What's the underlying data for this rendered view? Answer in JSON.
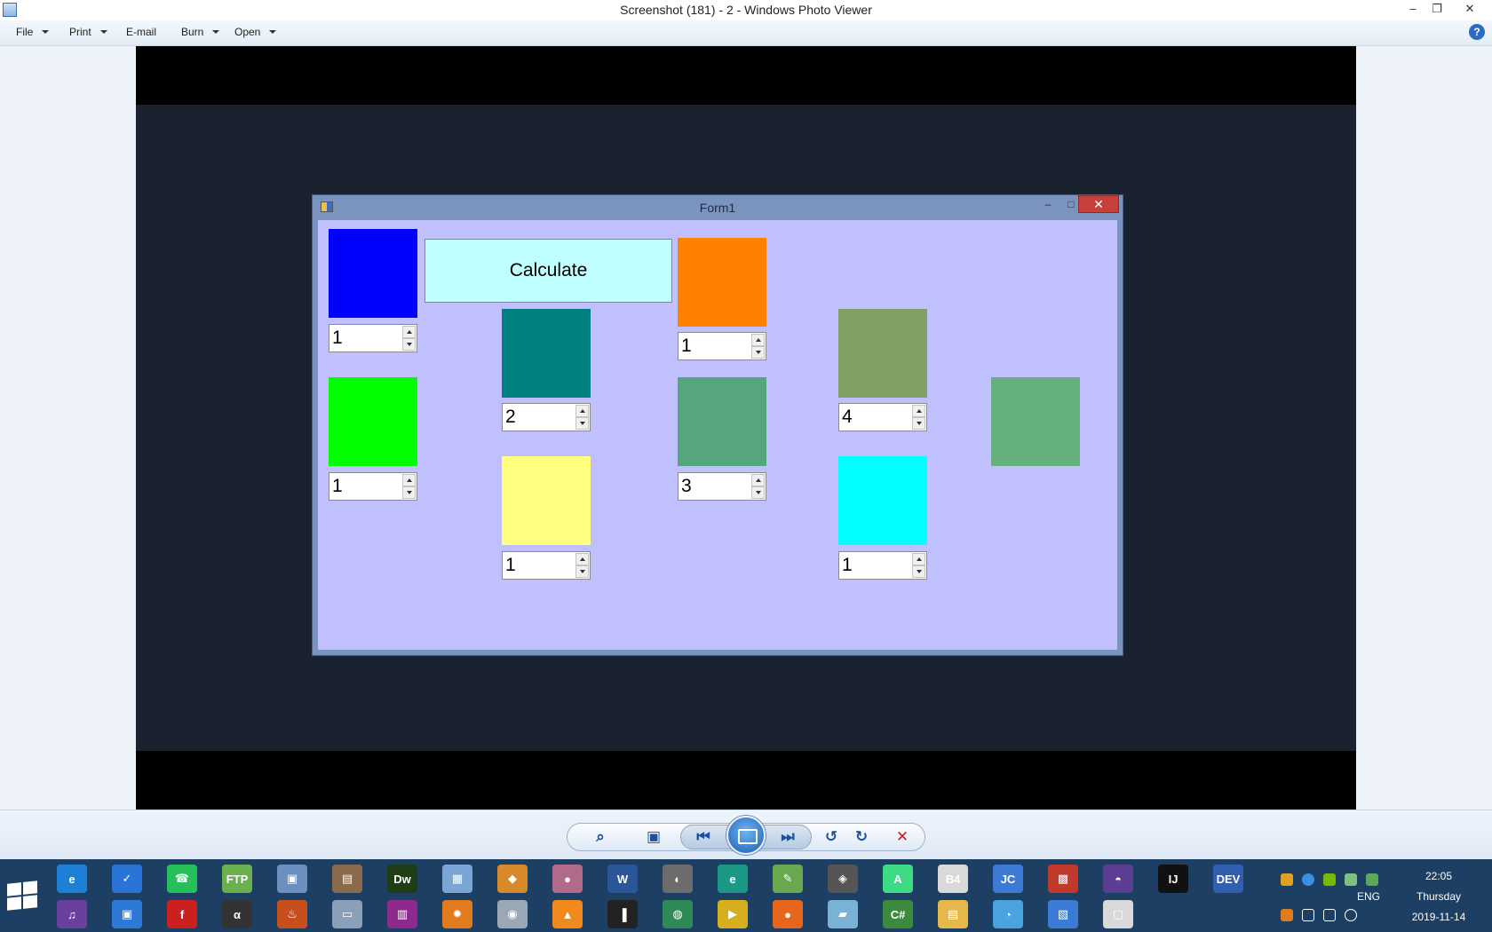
{
  "window": {
    "title": "Screenshot (181) - 2 - Windows Photo Viewer",
    "minimize": "–",
    "restore": "❐",
    "close": "✕"
  },
  "menu": {
    "file": "File",
    "print": "Print",
    "email": "E-mail",
    "burn": "Burn",
    "open": "Open",
    "help": "?"
  },
  "form": {
    "title": "Form1",
    "minimize": "–",
    "maximize": "□",
    "close": "✕",
    "calculate_label": "Calculate",
    "swatch_colors": {
      "blue": "#0000ff",
      "teal": "#008080",
      "orange": "#ff8000",
      "olive": "#809f60",
      "lime": "#00ff00",
      "seagreen": "#55a67e",
      "mintgreen": "#66b07e",
      "yellow": "#ffff80",
      "cyan": "#00ffff"
    },
    "spinners": {
      "blue": "1",
      "orange": "1",
      "teal": "2",
      "olive": "4",
      "lime": "1",
      "seagreen": "3",
      "yellow": "1",
      "cyan": "1"
    }
  },
  "controls": {
    "zoom_icon": "zoom-icon",
    "fit_icon": "fit-to-window-icon",
    "prev_icon": "previous-icon",
    "slideshow_icon": "slideshow-icon",
    "next_icon": "next-icon",
    "rotate_ccw_icon": "rotate-counterclockwise-icon",
    "rotate_cw_icon": "rotate-clockwise-icon",
    "delete_icon": "delete-icon"
  },
  "taskbar": {
    "language": "ENG",
    "time": "22:05",
    "day": "Thursday",
    "date": "2019-11-14",
    "row1": [
      {
        "name": "internet-explorer-icon",
        "label": "e",
        "color": "#1e7fd6"
      },
      {
        "name": "tasks-icon",
        "label": "✓",
        "color": "#2a74d8"
      },
      {
        "name": "whatsapp-icon",
        "label": "☎",
        "color": "#25c05a"
      },
      {
        "name": "cuteftp-icon",
        "label": "FTP",
        "color": "#6ab04c"
      },
      {
        "name": "computer-search-icon",
        "label": "▣",
        "color": "#6b8fbf"
      },
      {
        "name": "film-icon",
        "label": "▤",
        "color": "#8a6a4a"
      },
      {
        "name": "dreamweaver-icon",
        "label": "Dw",
        "color": "#1f3d17"
      },
      {
        "name": "calculator-icon",
        "label": "▦",
        "color": "#7aa6d6"
      },
      {
        "name": "paint-bucket-icon",
        "label": "◆",
        "color": "#d78a2a"
      },
      {
        "name": "disc-icon",
        "label": "●",
        "color": "#b06a8a"
      },
      {
        "name": "word-icon",
        "label": "W",
        "color": "#2b579a"
      },
      {
        "name": "shield-icon",
        "label": "◐",
        "color": "#6c6c6c"
      },
      {
        "name": "edge-e-icon",
        "label": "e",
        "color": "#1a9a86"
      },
      {
        "name": "notepad-plus-icon",
        "label": "✎",
        "color": "#6aa84f"
      },
      {
        "name": "penguin-icon",
        "label": "◈",
        "color": "#555555"
      },
      {
        "name": "android-studio-icon",
        "label": "A",
        "color": "#3ddc84"
      },
      {
        "name": "basic4android-icon",
        "label": "B4",
        "color": "#d9d9d9"
      },
      {
        "name": "jcreator-icon",
        "label": "JC",
        "color": "#3b7bd6"
      },
      {
        "name": "blocks-icon",
        "label": "▩",
        "color": "#c0392b"
      },
      {
        "name": "eclipse-icon",
        "label": "◓",
        "color": "#5b3e91"
      },
      {
        "name": "intellij-icon",
        "label": "IJ",
        "color": "#111111"
      },
      {
        "name": "devcpp-icon",
        "label": "DEV",
        "color": "#2f5fae"
      }
    ],
    "row2": [
      {
        "name": "music-icon",
        "label": "♫",
        "color": "#6a3fa0"
      },
      {
        "name": "window-switch-icon",
        "label": "▣",
        "color": "#2f79d6"
      },
      {
        "name": "flash-icon",
        "label": "f",
        "color": "#cc1f1f"
      },
      {
        "name": "alpha-icon",
        "label": "α",
        "color": "#333333"
      },
      {
        "name": "java-icon",
        "label": "♨",
        "color": "#c74f1c"
      },
      {
        "name": "monitor-icon",
        "label": "▭",
        "color": "#8aa0b8"
      },
      {
        "name": "winrar-icon",
        "label": "▥",
        "color": "#8e2a8e"
      },
      {
        "name": "paint-icon",
        "label": "✹",
        "color": "#e07b1e"
      },
      {
        "name": "camera-icon",
        "label": "◉",
        "color": "#9aa7b4"
      },
      {
        "name": "vlc-icon",
        "label": "▲",
        "color": "#f08a1c"
      },
      {
        "name": "piano-icon",
        "label": "▐",
        "color": "#222222"
      },
      {
        "name": "download-manager-icon",
        "label": "◍",
        "color": "#2e8b57"
      },
      {
        "name": "video-player-icon",
        "label": "▶",
        "color": "#d6b01c"
      },
      {
        "name": "firefox-icon",
        "label": "●",
        "color": "#e8661c"
      },
      {
        "name": "disk-icon",
        "label": "▰",
        "color": "#7ab2d6"
      },
      {
        "name": "csharp-icon",
        "label": "C#",
        "color": "#3c8a3c"
      },
      {
        "name": "file-explorer-icon",
        "label": "▤",
        "color": "#e6b84a"
      },
      {
        "name": "palette-icon",
        "label": "◔",
        "color": "#4aa3df"
      },
      {
        "name": "photo-viewer-icon",
        "label": "▧",
        "color": "#3b7bd6"
      },
      {
        "name": "form-app-icon",
        "label": "▢",
        "color": "#d9d9d9"
      }
    ]
  }
}
